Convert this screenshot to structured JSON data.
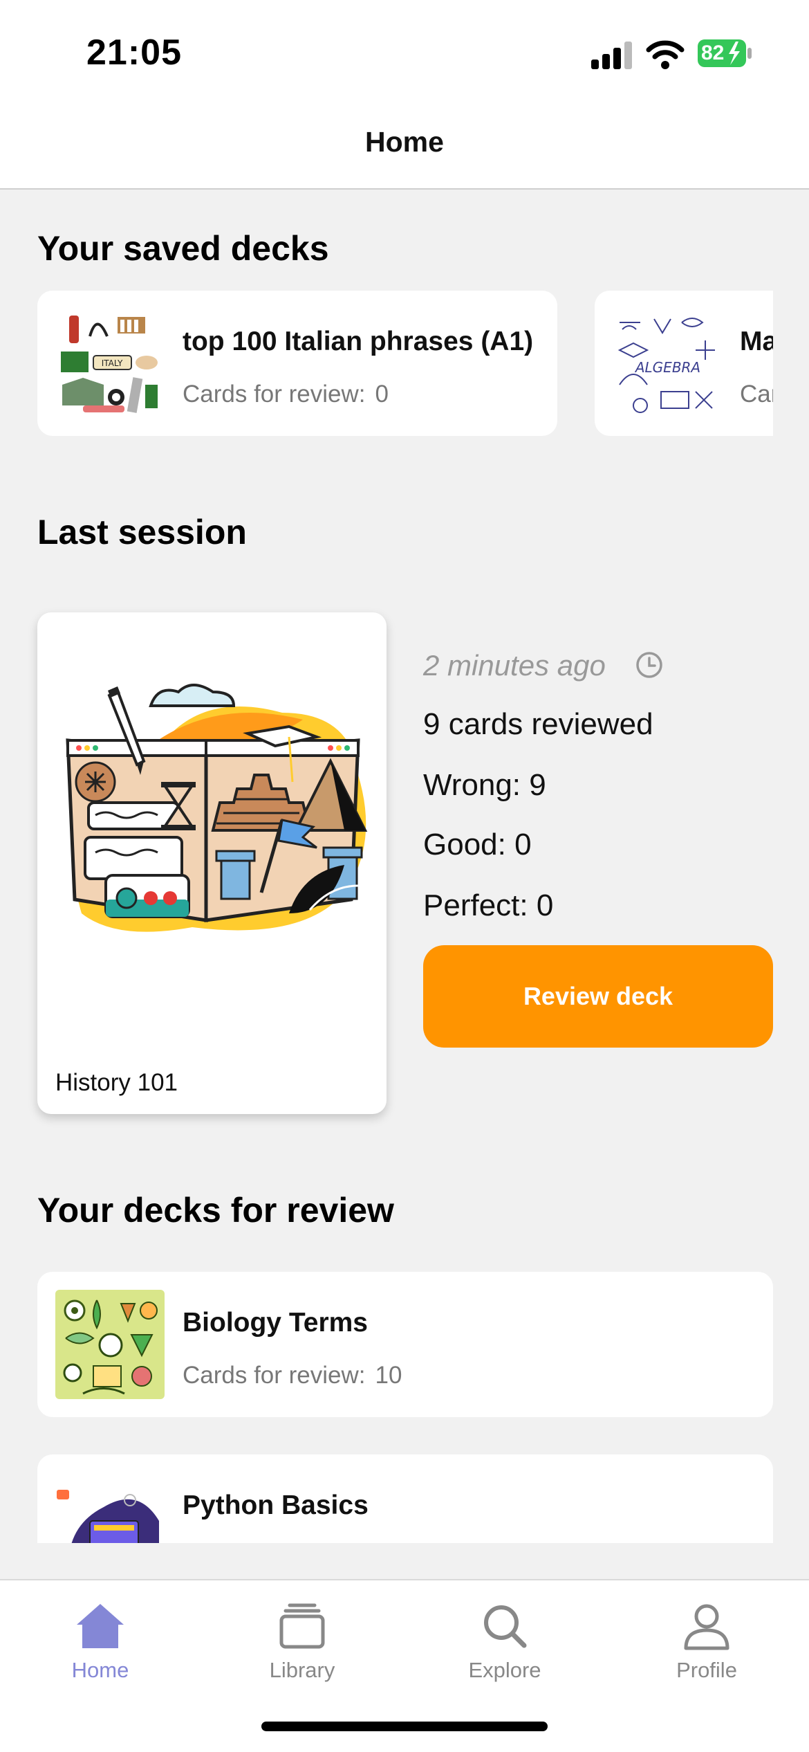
{
  "status": {
    "time": "21:05",
    "battery": "82"
  },
  "header": {
    "title": "Home"
  },
  "saved_decks": {
    "title": "Your saved decks",
    "items": [
      {
        "name": "top 100 Italian phrases (A1)",
        "review_label": "Cards for review:",
        "review_count": "0",
        "thumb": "italy-collage",
        "thumb_text": "ITALY"
      },
      {
        "name": "Ma",
        "review_label": "Car",
        "review_count": "",
        "thumb": "algebra-doodles",
        "thumb_text": "ALGEBRA"
      }
    ]
  },
  "last_session": {
    "title": "Last session",
    "deck_name": "History 101",
    "time_ago": "2 minutes ago",
    "cards_reviewed": "9 cards reviewed",
    "wrong": "Wrong: 9",
    "good": "Good: 0",
    "perfect": "Perfect: 0",
    "button_label": "Review deck"
  },
  "review_decks": {
    "title": "Your decks for review",
    "items": [
      {
        "name": "Biology Terms",
        "review_label": "Cards for review:",
        "review_count": "10",
        "thumb": "biology-doodles"
      },
      {
        "name": "Python Basics",
        "thumb": "python-illustration"
      }
    ]
  },
  "tabs": [
    {
      "label": "Home",
      "icon": "home-icon",
      "active": true
    },
    {
      "label": "Library",
      "icon": "library-icon",
      "active": false
    },
    {
      "label": "Explore",
      "icon": "search-icon",
      "active": false
    },
    {
      "label": "Profile",
      "icon": "profile-icon",
      "active": false
    }
  ],
  "colors": {
    "accent": "#ff9400",
    "tab_active": "#8487d6",
    "background": "#f1f1f1"
  }
}
